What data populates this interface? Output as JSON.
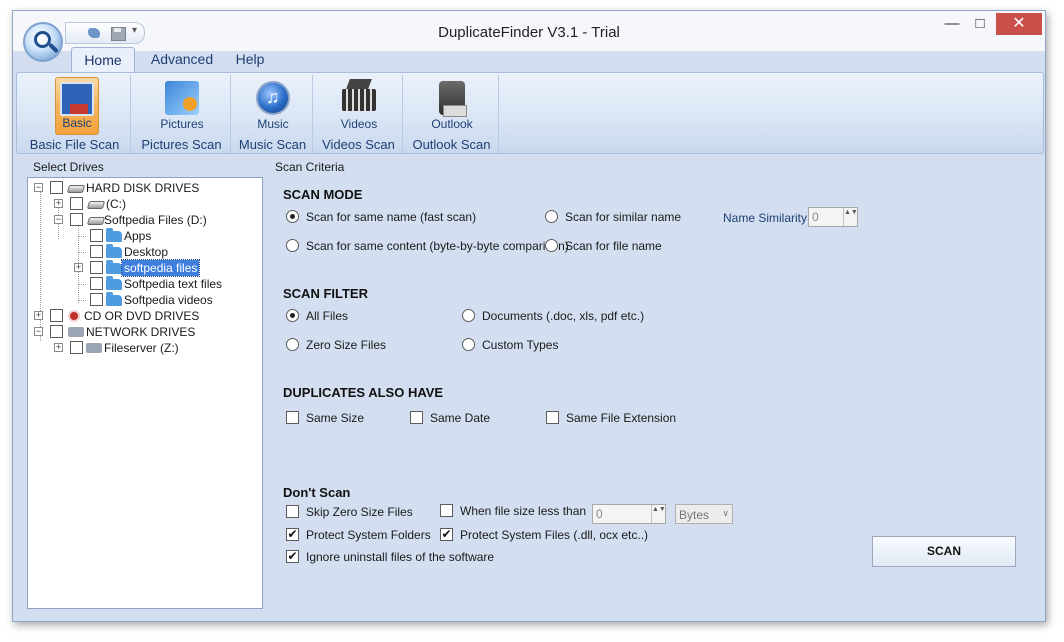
{
  "window": {
    "title": "DuplicateFinder V3.1 - Trial"
  },
  "title_controls": {
    "minimize": "—",
    "maximize": "□",
    "close": "✕"
  },
  "quick_access": {
    "more": "▾"
  },
  "tabs": [
    "Home",
    "Advanced",
    "Help"
  ],
  "ribbon": {
    "groups": [
      {
        "button": "Basic",
        "label": "Basic File Scan",
        "icon": "basic-scan-icon",
        "active": true
      },
      {
        "button": "Pictures",
        "label": "Pictures Scan",
        "icon": "pictures-icon",
        "active": false
      },
      {
        "button": "Music",
        "label": "Music Scan",
        "icon": "music-icon",
        "active": false
      },
      {
        "button": "Videos",
        "label": "Videos Scan",
        "icon": "videos-icon",
        "active": false
      },
      {
        "button": "Outlook",
        "label": "Outlook Scan",
        "icon": "outlook-icon",
        "active": false
      }
    ]
  },
  "drives": {
    "label": "Select Drives",
    "tree": [
      {
        "label": "HARD DISK DRIVES",
        "expander": "−"
      },
      {
        "label": "(C:)",
        "expander": "+"
      },
      {
        "label": "Softpedia Files (D:)",
        "expander": "−"
      },
      {
        "label": "Apps"
      },
      {
        "label": "Desktop"
      },
      {
        "label": "softpedia files",
        "expander": "+",
        "selected": true
      },
      {
        "label": "Softpedia text files"
      },
      {
        "label": "Softpedia videos"
      },
      {
        "label": "CD OR DVD DRIVES",
        "expander": "+"
      },
      {
        "label": "NETWORK DRIVES",
        "expander": "−"
      },
      {
        "label": "Fileserver (Z:)",
        "expander": "+"
      }
    ]
  },
  "criteria": {
    "label": "Scan Criteria",
    "scan_mode": {
      "title": "SCAN MODE",
      "options": [
        "Scan for same name (fast scan)",
        "Scan for similar name",
        "Scan for same content (byte-by-byte comparison)",
        "Scan for file name"
      ],
      "selected_index": 0,
      "name_similarity_label": "Name Similarity",
      "name_similarity_value": "0",
      "spin_arrows": "▲▼"
    },
    "scan_filter": {
      "title": "SCAN FILTER",
      "options": [
        "All Files",
        "Documents (.doc, xls, pdf etc.)",
        "Zero Size Files",
        "Custom Types"
      ],
      "selected_index": 0
    },
    "duplicates": {
      "title": "DUPLICATES ALSO HAVE",
      "options": [
        "Same Size",
        "Same Date",
        "Same File Extension"
      ],
      "checked": [
        false,
        false,
        false
      ]
    },
    "dont_scan": {
      "title": "Don't Scan",
      "skip_zero": {
        "label": "Skip Zero Size Files",
        "checked": false
      },
      "size_less": {
        "label": "When file size less than",
        "checked": false,
        "value": "0",
        "unit": "Bytes",
        "unit_arrow": "∨"
      },
      "protect_folders": {
        "label": "Protect System Folders",
        "checked": true
      },
      "protect_files": {
        "label": "Protect System Files (.dll, ocx etc..)",
        "checked": true
      },
      "ignore_uninstall": {
        "label": "Ignore uninstall files of the software",
        "checked": true
      },
      "check_mark": "✔"
    },
    "scan_button": "SCAN"
  },
  "colors": {
    "accent": "#f5b55c",
    "panel_bg": "#d3dff0",
    "selection": "#3d7ede"
  }
}
